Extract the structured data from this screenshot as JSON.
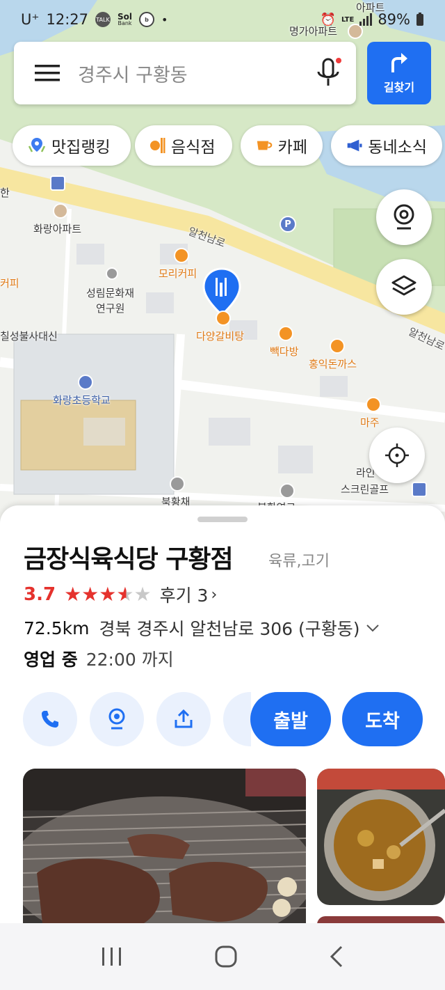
{
  "status_bar": {
    "carrier": "U⁺",
    "time": "12:27",
    "app_badge_talk": "TALK",
    "app_badge_sol": "Sol",
    "app_badge_sol_sub": "Bank",
    "dot": "•",
    "network": "LTE",
    "battery": "89%"
  },
  "search": {
    "placeholder": "경주시 구황동",
    "route_label": "길찾기"
  },
  "chips": [
    {
      "label": "맛집랭킹",
      "icon": "ranking-pin-icon"
    },
    {
      "label": "음식점",
      "icon": "restaurant-icon"
    },
    {
      "label": "카페",
      "icon": "cafe-cup-icon"
    },
    {
      "label": "동네소식",
      "icon": "megaphone-icon"
    }
  ],
  "map": {
    "labels": {
      "apt_top": "아파트",
      "myeongga": "명가아파트",
      "hwarang_apt": "화랑아파트",
      "road_alcheon1": "알천남로",
      "road_alcheon2": "알천남로",
      "mori_cafe": "모리커피",
      "seongrim1": "성림문화재",
      "seongrim2": "연구원",
      "dayang": "다양갈비탕",
      "ppaek": "빽다방",
      "hongik": "홍익돈까스",
      "chilseong": "칠성불사대신",
      "hwarang_school": "화랑초등학교",
      "maju": "마주",
      "la": "라인",
      "screen_golf": "스크린골프",
      "bukwang": "북황채",
      "hwang_left": "한",
      "cut_left": "커피",
      "bukhwang2": "북황연코"
    },
    "marker_color": "#1f6ff2"
  },
  "sheet": {
    "place_name": "금장식육식당 구황점",
    "category": "육류,고기",
    "rating": "3.7",
    "stars": [
      "on",
      "on",
      "on",
      "half",
      "off"
    ],
    "reviews": "후기 3",
    "distance": "72.5km",
    "address": "경북 경주시 알천남로 306 (구황동)",
    "open_status": "영업 중",
    "hours": "22:00 까지",
    "depart_label": "출발",
    "arrive_label": "도착"
  },
  "colors": {
    "accent": "#1f6ff2",
    "rating_red": "#e5322d",
    "poi_orange": "#f39324"
  }
}
